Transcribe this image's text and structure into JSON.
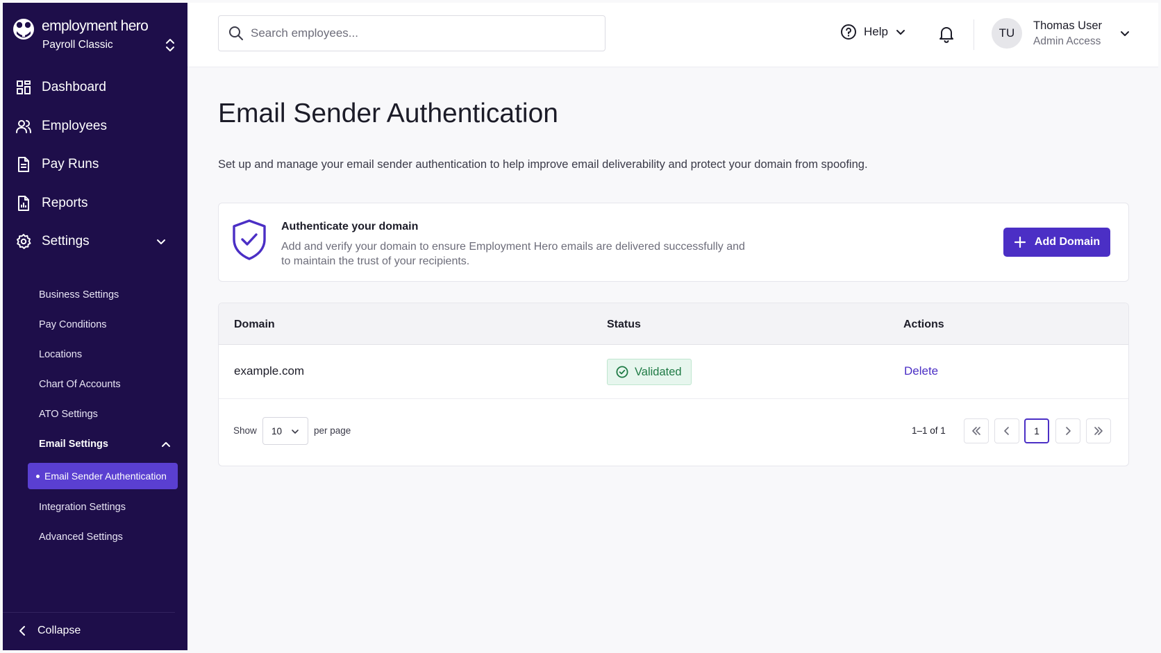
{
  "brand": {
    "name": "employment hero",
    "product": "Payroll Classic"
  },
  "colors": {
    "sidebar_bg": "#1e0e4a",
    "accent": "#4b2fc5",
    "active_item": "#5a3fd1",
    "success_bg": "#e7f6ee",
    "success_text": "#1f7a45"
  },
  "sidebar": {
    "nav": [
      {
        "label": "Dashboard",
        "icon": "dashboard-icon"
      },
      {
        "label": "Employees",
        "icon": "users-icon"
      },
      {
        "label": "Pay Runs",
        "icon": "document-icon"
      },
      {
        "label": "Reports",
        "icon": "report-icon"
      },
      {
        "label": "Settings",
        "icon": "gear-icon"
      }
    ],
    "settings_items": [
      "Business Settings",
      "Pay Conditions",
      "Locations",
      "Chart Of Accounts",
      "ATO Settings"
    ],
    "email_settings_label": "Email Settings",
    "active_item": "Email Sender Authentication",
    "after_items": [
      "Integration Settings",
      "Advanced Settings"
    ],
    "collapse_label": "Collapse"
  },
  "header": {
    "search_placeholder": "Search employees...",
    "help_label": "Help",
    "avatar_initials": "TU",
    "user_name": "Thomas User",
    "user_role": "Admin Access"
  },
  "main": {
    "title": "Email Sender Authentication",
    "description": "Set up and manage your email sender authentication to help improve email deliverability and protect your domain from spoofing.",
    "auth_card": {
      "title": "Authenticate your domain",
      "description": "Add and verify your domain to ensure Employment Hero emails are delivered successfully and to maintain the trust of your recipients.",
      "button_label": "Add Domain"
    },
    "table": {
      "columns": [
        "Domain",
        "Status",
        "Actions"
      ],
      "rows": [
        {
          "domain": "example.com",
          "status": "Validated",
          "action": "Delete"
        }
      ]
    },
    "pagination": {
      "show_label": "Show",
      "per_page_value": "10",
      "per_page_label": "per page",
      "range": "1–1 of 1",
      "current_page": "1"
    }
  }
}
